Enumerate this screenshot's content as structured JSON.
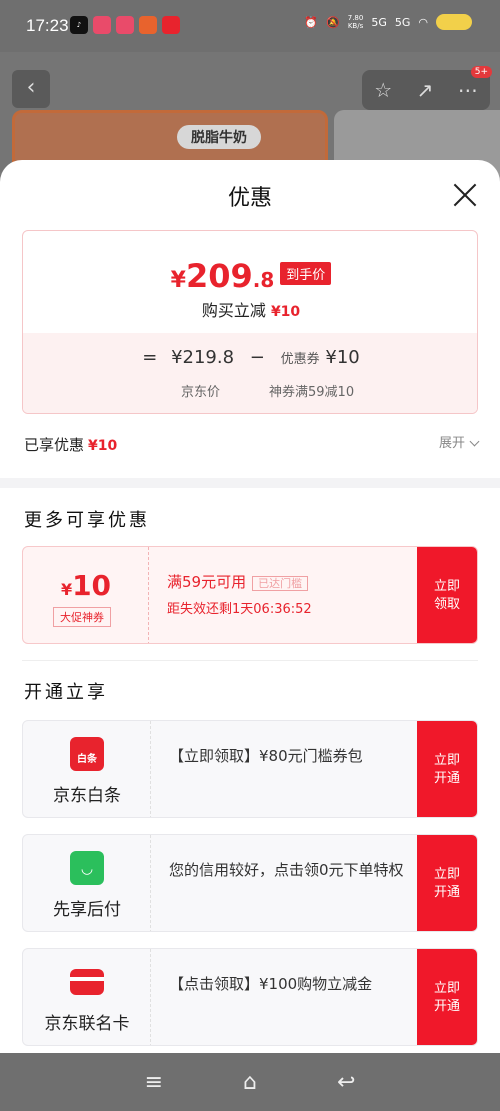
{
  "status_bar": {
    "time": "17:23",
    "net_speed": "7.80",
    "net_unit": "KB/s",
    "signal1": "5G",
    "signal2": "5G"
  },
  "background": {
    "product_label": "脱脂牛奶",
    "badge": "5+"
  },
  "sheet": {
    "title": "优惠",
    "price": {
      "yen": "¥",
      "int": "209",
      "dec": ".8",
      "tag": "到手价"
    },
    "reduce_label": "购买立减",
    "reduce_value": "¥10",
    "calc": {
      "equals": "=",
      "jd_price": "¥219.8",
      "minus": "−",
      "coupon_label": "优惠券",
      "coupon_value": "¥10",
      "jd_price_label": "京东价",
      "coupon_desc": "神券满59减10"
    },
    "enjoyed_label": "已享优惠",
    "enjoyed_value": "¥10",
    "expand_label": "展开"
  },
  "more": {
    "title": "更多可享优惠",
    "coupon": {
      "yen": "¥",
      "amount": "10",
      "kind": "大促神券",
      "condition": "满59元可用",
      "tag": "已达门槛",
      "countdown": "距失效还剩1天06:36:52",
      "button": "立即领取"
    }
  },
  "open": {
    "title": "开通立享",
    "services": [
      {
        "icon_text": "白条",
        "name": "京东白条",
        "desc": "【立即领取】¥80元门槛券包",
        "button": "立即开通"
      },
      {
        "icon_text": "◡",
        "name": "先享后付",
        "desc": "您的信用较好，点击领0元下单特权",
        "button": "立即开通"
      },
      {
        "icon_text": "",
        "name": "京东联名卡",
        "desc": "【点击领取】¥100购物立减金",
        "button": "立即开通"
      }
    ]
  },
  "nav": {
    "menu": "≡",
    "home": "⌂",
    "back": "↩"
  }
}
